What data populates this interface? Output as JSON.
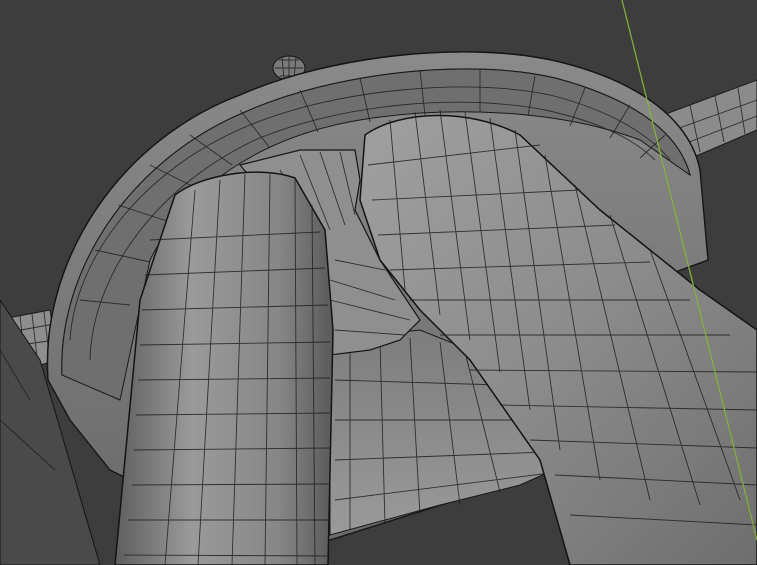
{
  "viewport": {
    "background_color": "#3d3d3d",
    "mesh_color": "#8f8f8f",
    "mesh_shadow_color": "#6c6c6c",
    "wire_color": "#1e1e1e",
    "axis_line_color": "#84b336"
  },
  "objects": {
    "bowl": "bowl-mesh",
    "left_tube": "tube-mesh",
    "right_tube": "tube-mesh",
    "side_rod_left": "rod-mesh",
    "side_rod_right": "rod-mesh",
    "small_sphere": "sphere-mesh",
    "axis_line": "y-axis-line"
  }
}
